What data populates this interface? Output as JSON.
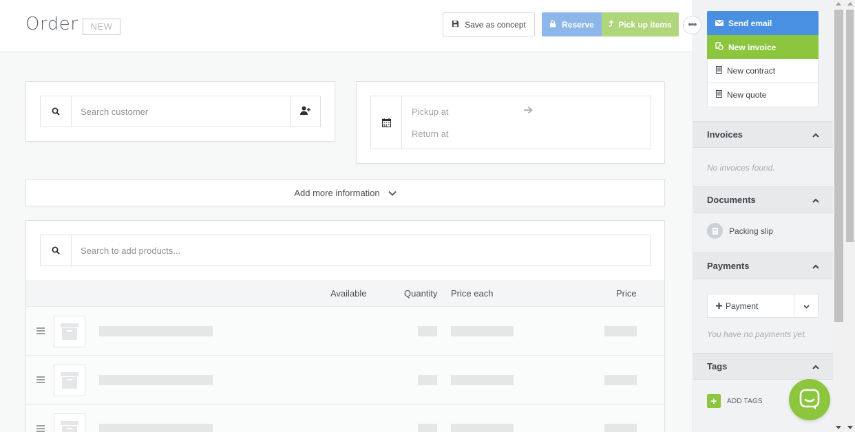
{
  "header": {
    "title": "Order",
    "badge": "NEW",
    "save_concept_label": "Save as concept",
    "reserve_label": "Reserve",
    "pickup_label": "Pick up items",
    "more_label": "•••"
  },
  "customer": {
    "search_placeholder": "Search customer"
  },
  "dates": {
    "pickup_label": "Pickup at",
    "return_label": "Return at"
  },
  "more_info": {
    "label": "Add more information"
  },
  "products": {
    "search_placeholder": "Search to add products...",
    "columns": {
      "available": "Available",
      "quantity": "Quantity",
      "price_each": "Price each",
      "price": "Price"
    },
    "rows": [
      {
        "placeholder": true
      },
      {
        "placeholder": true
      },
      {
        "placeholder": true
      }
    ]
  },
  "sidebar": {
    "actions": {
      "send_email": "Send email",
      "new_invoice": "New invoice",
      "new_contract": "New contract",
      "new_quote": "New quote"
    },
    "invoices": {
      "title": "Invoices",
      "empty": "No invoices found."
    },
    "documents": {
      "title": "Documents",
      "items": [
        "Packing slip"
      ]
    },
    "payments": {
      "title": "Payments",
      "add_label": "Payment",
      "empty": "You have no payments yet."
    },
    "tags": {
      "title": "Tags",
      "add_label": "ADD TAGS"
    }
  },
  "colors": {
    "primary_blue": "#4a90e2",
    "reserve_blue_disabled": "#8db6ea",
    "primary_green": "#8cc63f",
    "pickup_green_disabled": "#afd67a"
  },
  "icons": {
    "save": "floppy-icon",
    "reserve": "lock-icon",
    "pickup": "arrow-up-icon",
    "search": "search-icon",
    "add_user": "add-user-icon",
    "calendar": "calendar-icon",
    "arrow": "arrow-right-icon",
    "email": "envelope-icon",
    "invoice": "invoice-icon",
    "document": "document-icon",
    "chat": "chat-icon"
  }
}
